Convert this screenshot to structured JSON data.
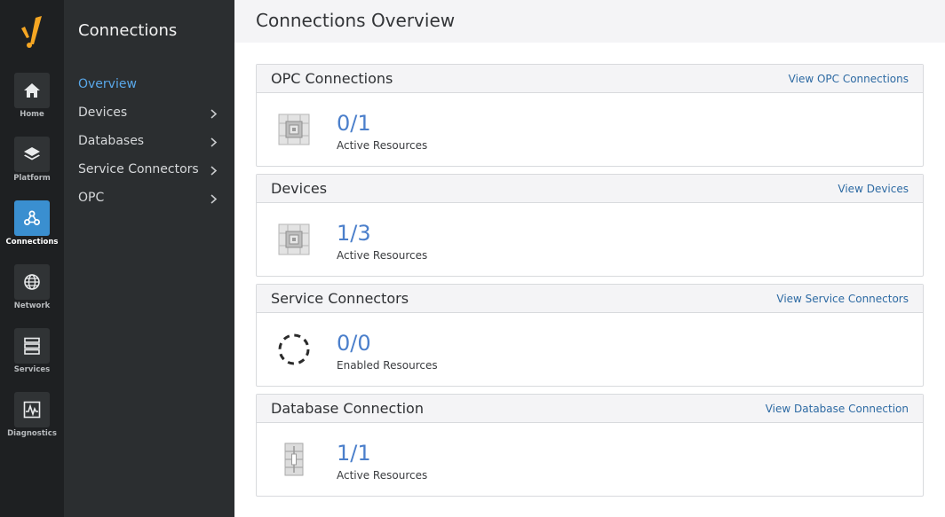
{
  "rail": {
    "items": [
      {
        "label": "Home",
        "icon": "home-icon"
      },
      {
        "label": "Platform",
        "icon": "layers-icon"
      },
      {
        "label": "Connections",
        "icon": "connections-icon"
      },
      {
        "label": "Network",
        "icon": "globe-icon"
      },
      {
        "label": "Services",
        "icon": "server-stack-icon"
      },
      {
        "label": "Diagnostics",
        "icon": "pulse-icon"
      }
    ],
    "active": "Connections",
    "logo": "brand-logo-icon"
  },
  "subnav": {
    "title": "Connections",
    "items": [
      {
        "label": "Overview"
      },
      {
        "label": "Devices"
      },
      {
        "label": "Databases"
      },
      {
        "label": "Service Connectors"
      },
      {
        "label": "OPC"
      }
    ],
    "active": "Overview"
  },
  "page": {
    "title": "Connections Overview"
  },
  "cards": [
    {
      "title": "OPC Connections",
      "link": "View OPC Connections",
      "value": "0/1",
      "caption": "Active Resources",
      "icon": "chip-icon"
    },
    {
      "title": "Devices",
      "link": "View Devices",
      "value": "1/3",
      "caption": "Active Resources",
      "icon": "chip-icon"
    },
    {
      "title": "Service Connectors",
      "link": "View Service Connectors",
      "value": "0/0",
      "caption": "Enabled Resources",
      "icon": "dashed-circle-icon"
    },
    {
      "title": "Database Connection",
      "link": "View Database Connection",
      "value": "1/1",
      "caption": "Active Resources",
      "icon": "database-icon"
    }
  ],
  "colors": {
    "accent": "#3a8fd0",
    "link": "#2d6aa3",
    "value": "#4b7fcb",
    "logo": "#f5a623"
  }
}
